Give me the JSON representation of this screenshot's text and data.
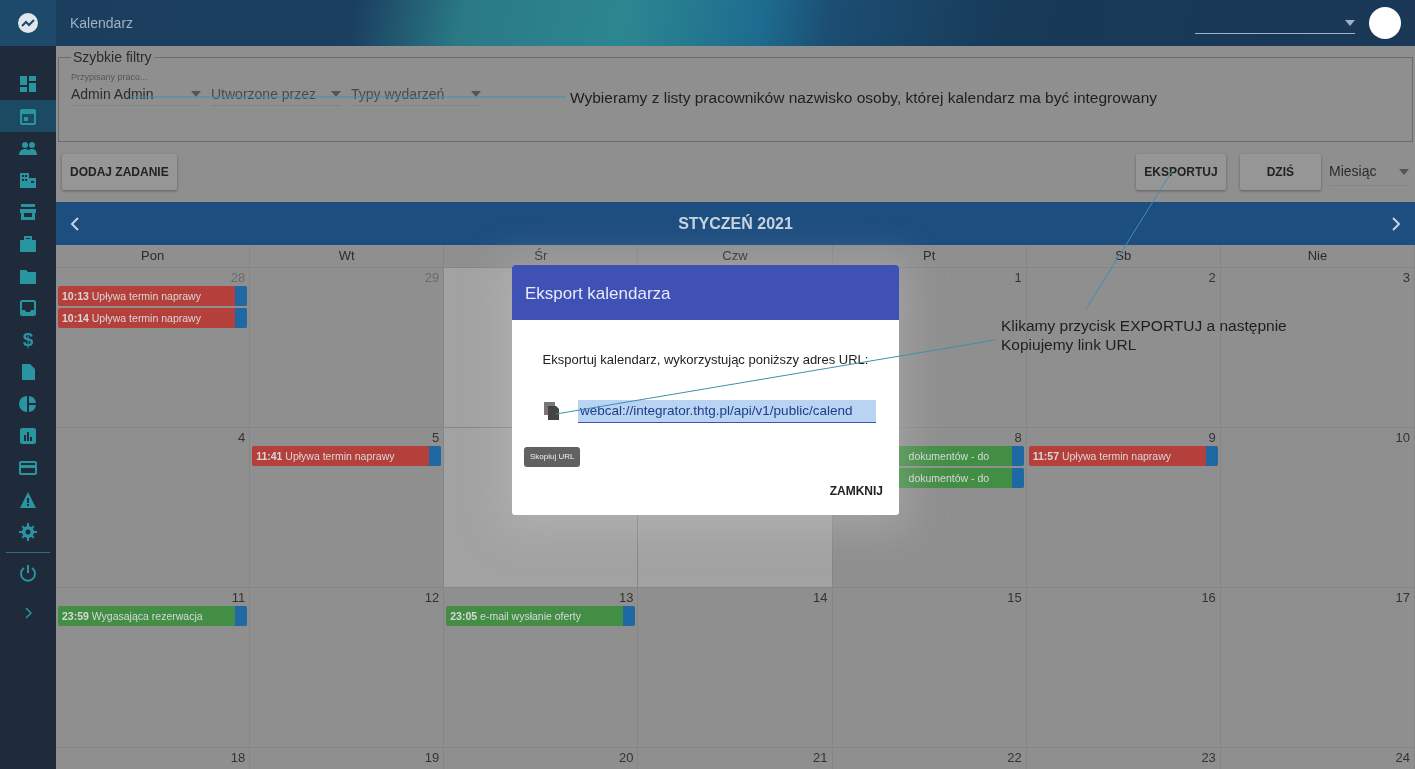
{
  "sidebar": {
    "items": [
      {
        "selected": false
      },
      {
        "selected": true
      },
      {
        "selected": false
      },
      {
        "selected": false
      },
      {
        "selected": false
      },
      {
        "selected": false
      },
      {
        "selected": false
      },
      {
        "selected": false
      },
      {
        "selected": false,
        "glyph": "$"
      },
      {
        "selected": false
      },
      {
        "selected": false
      },
      {
        "selected": false
      },
      {
        "selected": false
      },
      {
        "selected": false
      },
      {
        "selected": false
      },
      {
        "selected": false
      }
    ]
  },
  "header": {
    "title": "Kalendarz"
  },
  "filters": {
    "legend": "Szybkie filtry",
    "selects": [
      {
        "label": "Przypisany praco...",
        "value": "Admin Admin"
      },
      {
        "placeholder": "Utworzone przez"
      },
      {
        "placeholder": "Typy wydarzeń"
      }
    ]
  },
  "toolbar": {
    "left_buttons": [
      "DODAJ ZADANIE"
    ],
    "right_buttons": [
      "EKSPORTUJ",
      "DZIŚ"
    ],
    "view_select": "Miesiąc"
  },
  "calendar": {
    "title": "STYCZEŃ 2021",
    "weekdays": [
      "Pon",
      "Wt",
      "Śr",
      "Czw",
      "Pt",
      "Sb",
      "Nie"
    ],
    "weeks": [
      {
        "left_days": [
          {
            "number": "28",
            "muted": true,
            "events": [
              {
                "time": "10:13",
                "title": "Upływa termin naprawy",
                "color": "#b5403b"
              },
              {
                "time": "10:14",
                "title": "Upływa termin naprawy",
                "color": "#b5403b"
              }
            ]
          },
          {
            "number": "29",
            "muted": true
          }
        ],
        "right_days": [
          {
            "number": "1",
            "muted": false
          },
          {
            "number": "2",
            "muted": false
          },
          {
            "number": "3",
            "muted": false
          }
        ]
      },
      {
        "left_days": [
          {
            "number": "4",
            "muted": false
          },
          {
            "number": "5",
            "muted": false,
            "events": [
              {
                "time": "11:41",
                "title": "Upływa termin naprawy",
                "color": "#b5403b"
              }
            ]
          }
        ],
        "right_days": [
          {
            "number": "8",
            "muted": false,
            "events": [
              {
                "title": "dokumentów - do",
                "color": "#438e45"
              },
              {
                "title": "dokumentów - do",
                "color": "#438e45"
              }
            ]
          },
          {
            "number": "9",
            "muted": false,
            "events": [
              {
                "time": "11:57",
                "title": "Upływa termin naprawy",
                "color": "#b5403b"
              }
            ]
          },
          {
            "number": "10",
            "muted": false
          }
        ]
      },
      {
        "days": [
          {
            "number": "11",
            "muted": false,
            "events": [
              {
                "time": "23:59",
                "title": "Wygasająca rezerwacja",
                "color": "#438e45"
              }
            ]
          },
          {
            "number": "12",
            "muted": false
          },
          {
            "number": "13",
            "muted": false,
            "events": [
              {
                "time": "23:05",
                "title": "e-mail wysłanie oferty",
                "color": "#438e45"
              }
            ]
          },
          {
            "number": "14",
            "muted": false
          },
          {
            "number": "15",
            "muted": false
          },
          {
            "number": "16",
            "muted": false
          },
          {
            "number": "17",
            "muted": false
          }
        ]
      },
      {
        "days": [
          {
            "number": "18",
            "muted": false
          },
          {
            "number": "19",
            "muted": false
          },
          {
            "number": "20",
            "muted": false
          },
          {
            "number": "21",
            "muted": false
          },
          {
            "number": "22",
            "muted": false
          },
          {
            "number": "23",
            "muted": false
          },
          {
            "number": "24",
            "muted": false
          }
        ]
      }
    ]
  },
  "dialog": {
    "title": "Eksport kalendarza",
    "text": "Eksportuj kalendarz, wykorzystując poniższy adres URL:",
    "url": "webcal://integrator.thtg.pl/api/v1/public/calend",
    "url_selected": true,
    "tooltip": "Skopiuj URL",
    "button": "ZAMKNIJ"
  },
  "annotations": [
    {
      "text": "Wybieramy z listy pracowników nazwisko osoby, której kalendarz ma być integrowany"
    },
    {
      "text": "Klikamy przycisk EXPORTUJ a następnie Kopiujemy link URL"
    }
  ]
}
